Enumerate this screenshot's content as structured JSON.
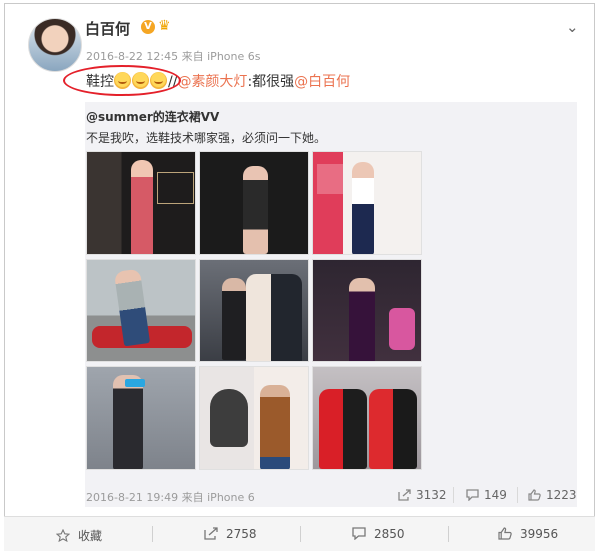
{
  "post": {
    "username": "白百何",
    "vip_badge": "V",
    "timestamp": "2016-8-22 12:45",
    "source_prefix": "来自",
    "source_device": "iPhone 6s",
    "text_prefix": "鞋控",
    "text_slash": "//",
    "mention_1": "@素颜大灯",
    "text_middle": ":都很强",
    "mention_2": "@白百何"
  },
  "original": {
    "author": "@summer的连衣裙VV",
    "text": "不是我吹，选鞋技术哪家强，必须问一下她。",
    "timestamp": "2016-8-21 19:49",
    "source_prefix": "来自",
    "source_device": "iPhone 6",
    "reposts": "3132",
    "comments": "149",
    "likes": "1223"
  },
  "photos": [
    "photo-1",
    "photo-2",
    "photo-3",
    "photo-4",
    "photo-5",
    "photo-6",
    "photo-7",
    "photo-8",
    "photo-9"
  ],
  "actions": {
    "favorite": "收藏",
    "repost": "2758",
    "comment": "2850",
    "like": "39956"
  },
  "colors": {
    "mention": "#eb7350",
    "highlight_oval": "#e4202a",
    "original_bg": "#f2f2f5"
  },
  "icons": {
    "more": "chevron-down-icon",
    "favorite": "star-icon",
    "repost": "share-icon",
    "comment": "comment-icon",
    "like": "thumb-up-icon"
  }
}
